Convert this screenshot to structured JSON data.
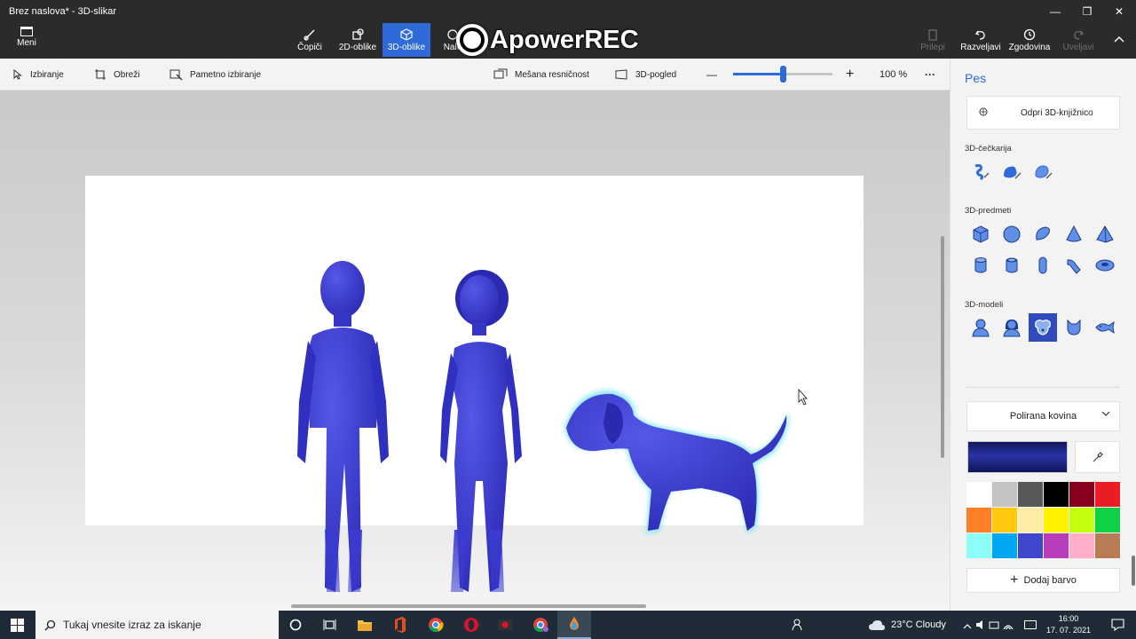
{
  "window": {
    "title": "Brez naslova* - 3D-slikar",
    "minimize_icon": "—",
    "maximize_icon": "❐",
    "close_icon": "✕"
  },
  "ribbon": {
    "menu_label": "Meni",
    "tabs": [
      {
        "label": "Čopiči",
        "icon": "brush-icon"
      },
      {
        "label": "2D-oblike",
        "icon": "2d-shapes-icon"
      },
      {
        "label": "3D-oblike",
        "icon": "3d-shapes-icon",
        "active": true
      },
      {
        "label": "Nale",
        "icon": "stickers-icon"
      }
    ],
    "right_tabs": [
      {
        "label": "Prilepi",
        "icon": "paste-icon",
        "enabled": false
      },
      {
        "label": "Razveljavi",
        "icon": "undo-icon",
        "enabled": true
      },
      {
        "label": "Zgodovina",
        "icon": "history-icon",
        "enabled": true
      },
      {
        "label": "Uveljavi",
        "icon": "redo-icon",
        "enabled": false
      }
    ],
    "collapse_icon": "chevron-up-icon"
  },
  "watermark": {
    "text": "ApowerREC"
  },
  "toolbar": {
    "select_label": "Izbiranje",
    "crop_label": "Obreži",
    "magic_select_label": "Pametno izbiranje",
    "mixed_reality_label": "Mešana resničnost",
    "view3d_label": "3D-pogled",
    "zoom_minus": "—",
    "zoom_plus": "+",
    "zoom_fraction": 0.5,
    "zoom_value": "100 %",
    "more_label": "···"
  },
  "panel": {
    "title": "Pes",
    "library_label": "Odpri 3D-knjižnico",
    "doodle_section": "3D-čečkarija",
    "doodle_icons": [
      "sharp-edge-doodle-icon",
      "soft-edge-doodle-icon",
      "tube-doodle-icon"
    ],
    "objects_section": "3D-predmeti",
    "object_icons": [
      "cube-icon",
      "sphere-icon",
      "hemisphere-icon",
      "cone-icon",
      "pyramid-icon",
      "cylinder-icon",
      "tube-icon",
      "capsule-icon",
      "curved-tube-icon",
      "donut-icon"
    ],
    "models_section": "3D-modeli",
    "model_icons": [
      "man-model-icon",
      "woman-model-icon",
      "dog-model-icon",
      "cat-model-icon",
      "fish-model-icon"
    ],
    "selected_model": "dog-model-icon",
    "material_label": "Polirana kovina",
    "current_color": "#1f2590",
    "palette": [
      "#ffffff",
      "#c3c3c3",
      "#585858",
      "#000000",
      "#88001b",
      "#ec1c24",
      "#ff7f27",
      "#ffc90e",
      "#fdeca6",
      "#fff200",
      "#c4ff0e",
      "#0ed145",
      "#8cfffb",
      "#00a8f3",
      "#3f48cc",
      "#b83dba",
      "#ffaec8",
      "#b97a56"
    ],
    "add_color_label": "Dodaj barvo"
  },
  "scene": {
    "model_color": "#3b3bd0",
    "selection_glow": "#8fe7f7",
    "selected_object": "Pes"
  },
  "taskbar": {
    "search_placeholder": "Tukaj vnesite izraz za iskanje",
    "apps": [
      "cortana-icon",
      "task-view-icon",
      "file-explorer-icon",
      "office-icon",
      "chrome-icon",
      "opera-icon",
      "screen-recorder-icon",
      "chrome-profile-icon",
      "paint3d-icon"
    ],
    "active_app": "paint3d-icon",
    "weather": "23°C  Cloudy",
    "time": "16:00",
    "date": "17. 07. 2021"
  }
}
